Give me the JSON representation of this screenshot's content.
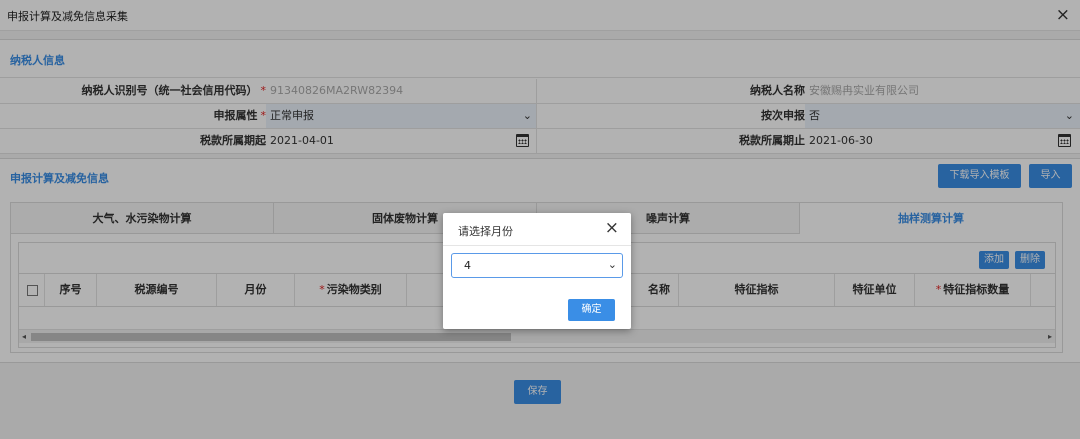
{
  "window": {
    "title": "申报计算及减免信息采集",
    "close_icon": "×"
  },
  "taxpayer": {
    "section_title": "纳税人信息",
    "id_label": "纳税人识别号（统一社会信用代码）",
    "id_value": "91340826MA2RW82394",
    "name_label": "纳税人名称",
    "name_value": "安徽赐冉实业有限公司",
    "attr_label": "申报属性",
    "attr_value": "正常申报",
    "by_time_label": "按次申报",
    "by_time_value": "否",
    "period_start_label": "税款所属期起",
    "period_start_value": "2021-04-01",
    "period_end_label": "税款所属期止",
    "period_end_value": "2021-06-30",
    "required_mark": "*"
  },
  "calc": {
    "section_title": "申报计算及减免信息",
    "download_button": "下载导入模板",
    "import_button": "导入",
    "tabs": [
      "大气、水污染物计算",
      "固体废物计算",
      "噪声计算",
      "抽样测算计算"
    ],
    "add_button": "添加",
    "delete_button": "删除",
    "columns": [
      "序号",
      "税源编号",
      "月份",
      "污染物类别",
      "名称",
      "特征指标",
      "特征单位",
      "特征指标数量"
    ],
    "scroll_left": "◂",
    "scroll_right": "▸"
  },
  "save_button": "保存",
  "modal": {
    "title": "请选择月份",
    "selected_month": "4",
    "ok_button": "确定"
  },
  "colors": {
    "accent": "#3a8ee6",
    "required": "#e02020"
  }
}
